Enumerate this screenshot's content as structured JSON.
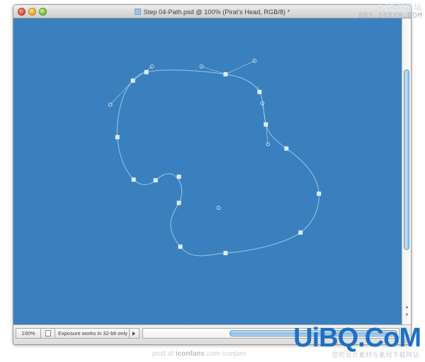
{
  "window": {
    "title": "Step 04-Path.psd @ 100% (Pirat's Head, RGB/8) *",
    "proxy_icon": "document-icon",
    "traffic_lights": [
      {
        "name": "close-button",
        "color": "#e0483b"
      },
      {
        "name": "minimize-button",
        "color": "#e3a822"
      },
      {
        "name": "zoom-button",
        "color": "#72ba33"
      }
    ]
  },
  "canvas": {
    "background_color": "#3a80bf",
    "path_stroke_color": "#a9d2ef",
    "anchor_fill_color": "#cfe6f8",
    "anchor_stroke_color": "#ffffff",
    "document_name": "Pirat's Head",
    "path_name": "Step 04-Path"
  },
  "statusbar": {
    "zoom_level": "100%",
    "doc_icon": "document-thumbnail-icon",
    "message": "Exposure works in 32-bit only",
    "menu_arrow": "triangle-right-icon",
    "resize_grip": "resize-grip-icon"
  },
  "scrollbars": {
    "vertical_up_arrow": "▲",
    "vertical_down_arrow": "▼"
  },
  "watermarks": {
    "top_right_line1": "PS教程论坛",
    "top_right_line2": "BBS.16XX8.COM",
    "bottom_right_main": "UiBQ.CoM",
    "bottom_right_sub": "您的设计素材与素材下载网站",
    "bottom_center_prefix": "post at ",
    "bottom_center_brand": "iconfans",
    "bottom_center_suffix": ".com",
    "bottom_center_script": "iconfans"
  }
}
